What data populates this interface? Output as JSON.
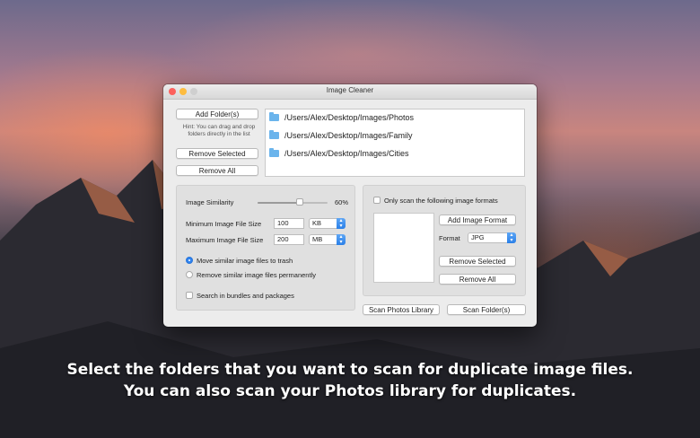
{
  "window": {
    "title": "Image Cleaner"
  },
  "folders": {
    "add_label": "Add Folder(s)",
    "hint": "Hint: You can drag and drop folders directly in the list",
    "remove_selected_label": "Remove Selected",
    "remove_all_label": "Remove All",
    "items": [
      "/Users/Alex/Desktop/Images/Photos",
      "/Users/Alex/Desktop/Images/Family",
      "/Users/Alex/Desktop/Images/Cities"
    ]
  },
  "options": {
    "similarity_label": "Image Similarity",
    "similarity_value": "60%",
    "similarity_fraction": 0.6,
    "min_size_label": "Minimum Image File Size",
    "min_size_value": "100",
    "min_size_unit": "KB",
    "max_size_label": "Maximum Image File Size",
    "max_size_value": "200",
    "max_size_unit": "MB",
    "move_trash_label": "Move similar image files to trash",
    "remove_permanent_label": "Remove similar image files permanently",
    "search_bundles_label": "Search in bundles and packages"
  },
  "formats": {
    "only_scan_label": "Only scan the following image formats",
    "add_label": "Add Image Format",
    "format_label": "Format",
    "format_value": "JPG",
    "remove_selected_label": "Remove Selected",
    "remove_all_label": "Remove All"
  },
  "actions": {
    "scan_photos_label": "Scan Photos Library",
    "scan_folders_label": "Scan Folder(s)"
  },
  "caption": {
    "line1": "Select the folders that you want to scan for duplicate image files.",
    "line2": "You can also scan your Photos library for duplicates."
  },
  "colors": {
    "accent": "#2f84f0",
    "folder": "#6ab4ec"
  }
}
